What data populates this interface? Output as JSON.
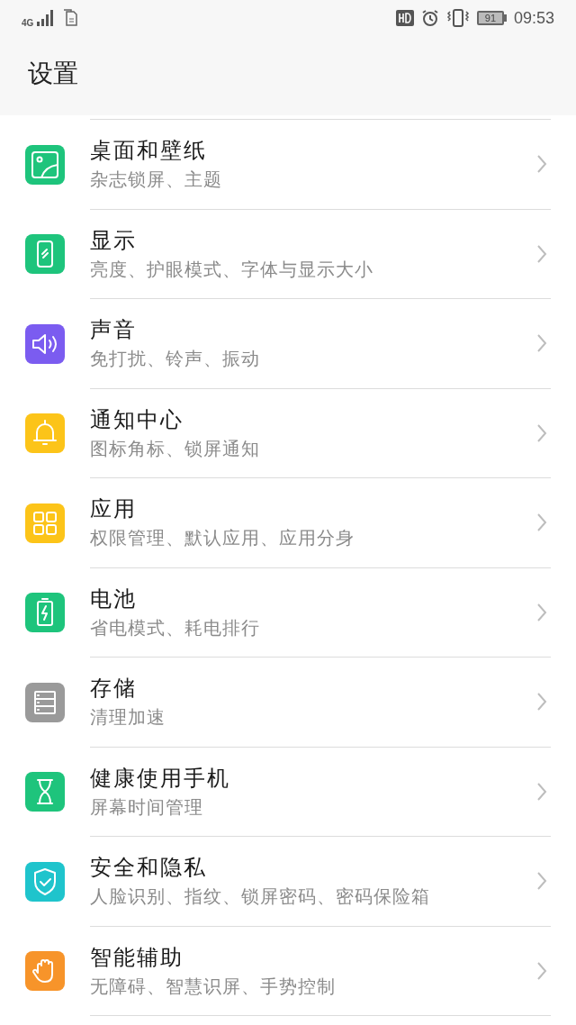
{
  "status_bar": {
    "network": "4G",
    "battery": "91",
    "time": "09:53"
  },
  "title": "设置",
  "items": [
    {
      "title": "桌面和壁纸",
      "subtitle": "杂志锁屏、主题",
      "kind": "picture",
      "color": "#1ec47c"
    },
    {
      "title": "显示",
      "subtitle": "亮度、护眼模式、字体与显示大小",
      "kind": "phone",
      "color": "#1ec47c"
    },
    {
      "title": "声音",
      "subtitle": "免打扰、铃声、振动",
      "kind": "speaker",
      "color": "#7b5cf0"
    },
    {
      "title": "通知中心",
      "subtitle": "图标角标、锁屏通知",
      "kind": "bell",
      "color": "#fcc419"
    },
    {
      "title": "应用",
      "subtitle": "权限管理、默认应用、应用分身",
      "kind": "grid",
      "color": "#fcc419"
    },
    {
      "title": "电池",
      "subtitle": "省电模式、耗电排行",
      "kind": "battery",
      "color": "#1ec47c"
    },
    {
      "title": "存储",
      "subtitle": "清理加速",
      "kind": "storage",
      "color": "#9a9a9a"
    },
    {
      "title": "健康使用手机",
      "subtitle": "屏幕时间管理",
      "kind": "hourglass",
      "color": "#1ec47c"
    },
    {
      "title": "安全和隐私",
      "subtitle": "人脸识别、指纹、锁屏密码、密码保险箱",
      "kind": "shield",
      "color": "#1fc4cc"
    },
    {
      "title": "智能辅助",
      "subtitle": "无障碍、智慧识屏、手势控制",
      "kind": "hand",
      "color": "#f7942a"
    }
  ]
}
